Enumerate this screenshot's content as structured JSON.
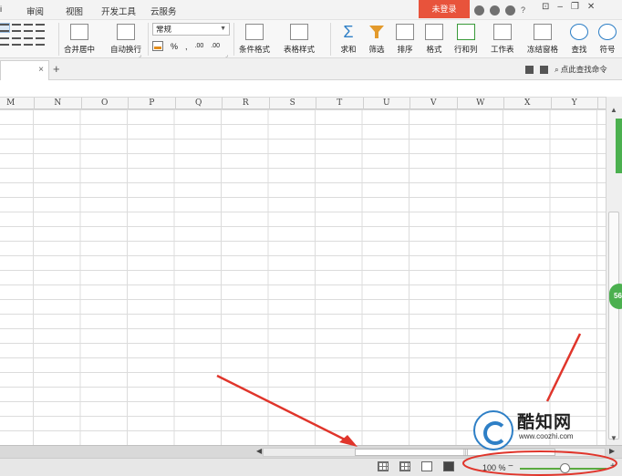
{
  "menu": {
    "items": [
      "审阅",
      "视图",
      "开发工具",
      "云服务"
    ],
    "first_partial": "i"
  },
  "login_label": "未登录",
  "help_label": "?",
  "ribbon": {
    "merge_center": "合并居中",
    "wrap_text": "自动换行",
    "number_format": "常规",
    "percent": "%",
    "comma": ",",
    "dec_inc": ".00",
    "dec_dec": ".00",
    "cond_format": "条件格式",
    "table_style": "表格样式",
    "sum": "求和",
    "filter": "筛选",
    "sort": "排序",
    "format": "格式",
    "row_col": "行和列",
    "worksheet": "工作表",
    "freeze": "冻结窗格",
    "find": "查找",
    "symbol": "符号"
  },
  "tabbar": {
    "close": "×",
    "new_tab": "+",
    "search_command": "点此查找命令"
  },
  "columns": [
    "M",
    "N",
    "O",
    "P",
    "Q",
    "R",
    "S",
    "T",
    "U",
    "V",
    "W",
    "X",
    "Y"
  ],
  "side_badge": "56",
  "status": {
    "zoom_label": "100 %",
    "zoom_minus": "−",
    "zoom_plus": "+",
    "zoom_level_percent": 100
  },
  "watermark": {
    "brand": "酷知网",
    "url": "www.coozhi.com"
  },
  "colors": {
    "login_bg": "#e8533b",
    "annotation_red": "#e0352b",
    "zoom_track": "#5aaa40",
    "side_badge": "#4bb04f"
  }
}
